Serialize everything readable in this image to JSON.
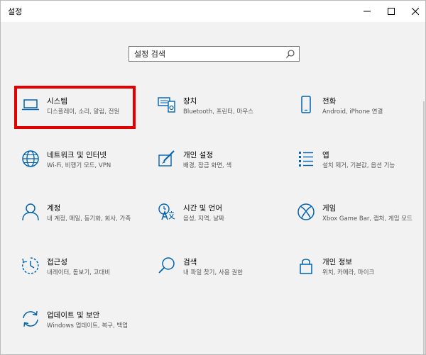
{
  "window": {
    "title": "설정"
  },
  "search": {
    "placeholder": "설정 검색"
  },
  "colors": {
    "accent": "#0063b1",
    "highlight": "#e30000"
  },
  "tiles": [
    {
      "title": "시스템",
      "desc": "디스플레이, 소리, 알림, 전원",
      "icon": "laptop-icon"
    },
    {
      "title": "장치",
      "desc": "Bluetooth, 프린터, 마우스",
      "icon": "devices-icon"
    },
    {
      "title": "전화",
      "desc": "Android, iPhone 연결",
      "icon": "phone-icon"
    },
    {
      "title": "네트워크 및 인터넷",
      "desc": "Wi-Fi, 비행기 모드, VPN",
      "icon": "globe-icon"
    },
    {
      "title": "개인 설정",
      "desc": "배경, 잠금 화면, 색",
      "icon": "paint-icon"
    },
    {
      "title": "앱",
      "desc": "설치 제거, 기본값, 옵션 기능",
      "icon": "apps-list-icon"
    },
    {
      "title": "계정",
      "desc": "내 계정, 메일, 동기화, 회사, 가족",
      "icon": "person-icon"
    },
    {
      "title": "시간 및 언어",
      "desc": "음성, 지역, 날짜",
      "icon": "time-language-icon"
    },
    {
      "title": "게임",
      "desc": "Xbox Game Bar, 캡처, 게임 모드",
      "icon": "xbox-icon"
    },
    {
      "title": "접근성",
      "desc": "내레이터, 돋보기, 고대비",
      "icon": "accessibility-icon"
    },
    {
      "title": "검색",
      "desc": "내 파일 찾기, 사용 권한",
      "icon": "search-icon"
    },
    {
      "title": "개인 정보",
      "desc": "위치, 카메라, 마이크",
      "icon": "lock-icon"
    },
    {
      "title": "업데이트 및 보안",
      "desc": "Windows 업데이트, 복구, 백업",
      "icon": "sync-icon"
    }
  ]
}
